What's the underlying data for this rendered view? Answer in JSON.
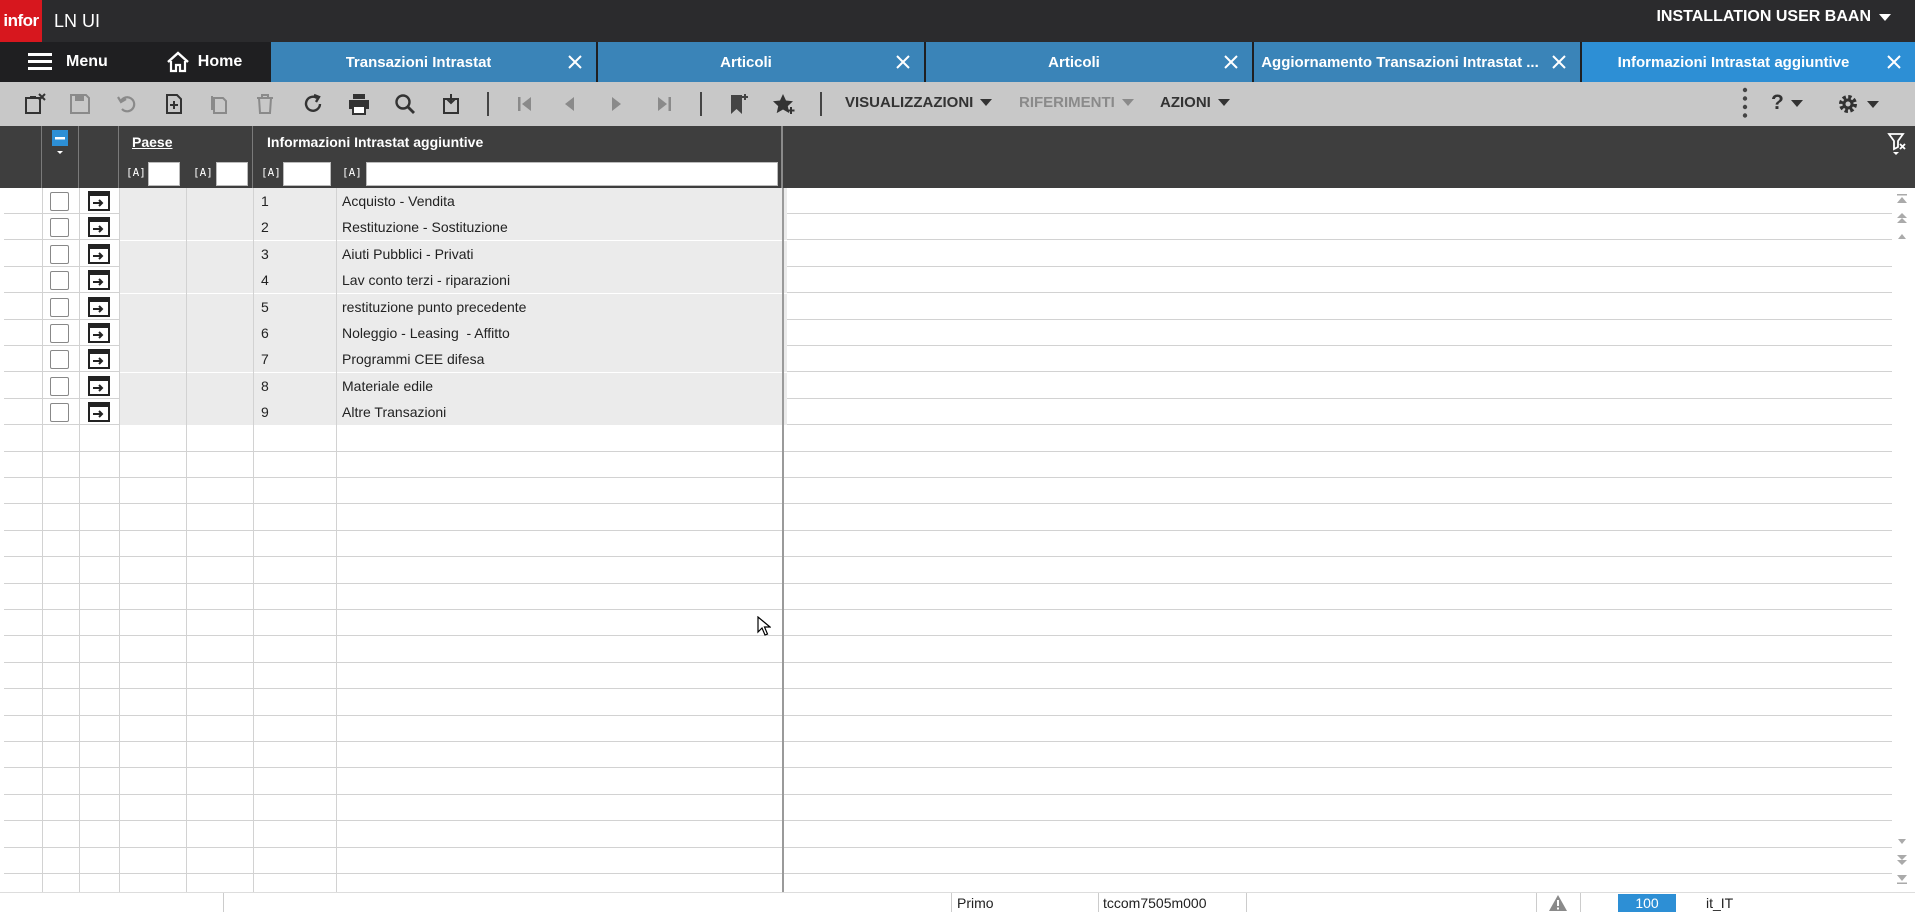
{
  "app": {
    "logo": "infor",
    "title": "LN UI",
    "user": "INSTALLATION USER BAAN"
  },
  "nav": {
    "menu_label": "Menu",
    "home_label": "Home",
    "tabs": [
      {
        "label": "Transazioni Intrastat"
      },
      {
        "label": "Articoli"
      },
      {
        "label": "Articoli"
      },
      {
        "label": "Aggiornamento Transazioni Intrastat ..."
      },
      {
        "label": "Informazioni Intrastat aggiuntive"
      }
    ]
  },
  "toolbar": {
    "views_label": "VISUALIZZAZIONI",
    "references_label": "RIFERIMENTI",
    "actions_label": "AZIONI",
    "help_label": "?"
  },
  "grid": {
    "columns": {
      "country": "Paese",
      "info": "Informazioni Intrastat aggiuntive"
    },
    "filter_tag": "[A]",
    "rows": [
      {
        "code": "1",
        "description": "Acquisto - Vendita"
      },
      {
        "code": "2",
        "description": "Restituzione - Sostituzione"
      },
      {
        "code": "3",
        "description": "Aiuti Pubblici - Privati"
      },
      {
        "code": "4",
        "description": "Lav conto terzi - riparazioni"
      },
      {
        "code": "5",
        "description": "restituzione punto precedente"
      },
      {
        "code": "6",
        "description": "Noleggio - Leasing  - Affitto"
      },
      {
        "code": "7",
        "description": "Programmi CEE difesa"
      },
      {
        "code": "8",
        "description": "Materiale edile"
      },
      {
        "code": "9",
        "description": "Altre Transazioni"
      }
    ]
  },
  "status": {
    "position": "Primo",
    "session": "tccom7505m000",
    "zoom": "100",
    "locale": "it_IT"
  },
  "colors": {
    "brand": "#d7171e",
    "tab": "#3a84b8",
    "tab_active": "#2d8fd5",
    "toolbar": "#c8c8c8",
    "grid_header": "#3e3e3e"
  }
}
